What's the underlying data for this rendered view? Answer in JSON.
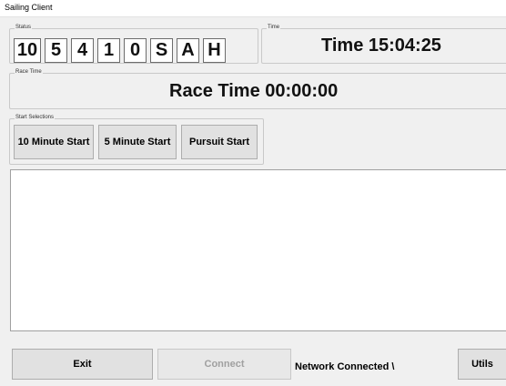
{
  "window": {
    "title": "Sailing Client"
  },
  "status_group": {
    "legend": "Status",
    "cells": [
      "10",
      "5",
      "4",
      "1",
      "0",
      "S",
      "A",
      "H"
    ]
  },
  "time_group": {
    "legend": "Time",
    "text": "Time 15:04:25"
  },
  "race_group": {
    "legend": "Race Time",
    "text": "Race Time 00:00:00"
  },
  "start_group": {
    "legend": "Start Selections",
    "buttons": [
      "10 Minute Start",
      "5 Minute Start",
      "Pursuit Start"
    ]
  },
  "output_log": {
    "text": ""
  },
  "bottom": {
    "exit_label": "Exit",
    "connect_label": "Connect",
    "network_status": "Network Connected \\",
    "utils_label": "Utils"
  }
}
